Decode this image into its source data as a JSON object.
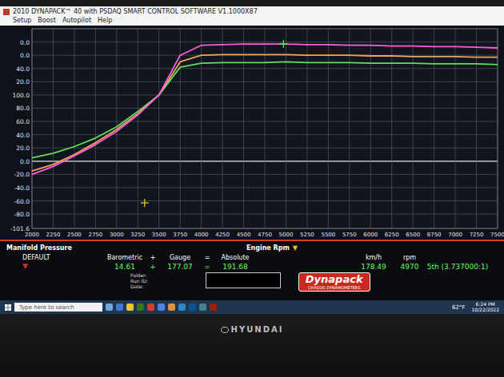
{
  "window": {
    "title": "2010 DYNAPACK™ 40 with PSDAQ SMART CONTROL SOFTWARE V1.1000X87",
    "menu": [
      "Setup",
      "Boost",
      "Autopilot",
      "Help"
    ]
  },
  "chart": {
    "y_ticks": [
      {
        "label": "0.0",
        "value": 180
      },
      {
        "label": "0.0",
        "value": 160
      },
      {
        "label": "40.0",
        "value": 140
      },
      {
        "label": "20.0",
        "value": 120
      },
      {
        "label": "100.0",
        "value": 100
      },
      {
        "label": "80.0",
        "value": 80
      },
      {
        "label": "60.0",
        "value": 60
      },
      {
        "label": "40.0",
        "value": 40
      },
      {
        "label": "20.0",
        "value": 20
      },
      {
        "label": "0.0",
        "value": 0
      },
      {
        "label": "-20.0",
        "value": -20
      },
      {
        "label": "-40.0",
        "value": -40
      },
      {
        "label": "-60.0",
        "value": -60
      },
      {
        "label": "-80.0",
        "value": -80
      },
      {
        "label": "-101.6",
        "value": -101.6
      }
    ],
    "x_ticks": [
      "2000",
      "2250",
      "2500",
      "2750",
      "3000",
      "3250",
      "3500",
      "3750",
      "4000",
      "4250",
      "4500",
      "4750",
      "5000",
      "5250",
      "5500",
      "5750",
      "6000",
      "6250",
      "6500",
      "6750",
      "7000",
      "7250",
      "7500"
    ],
    "rpm": [
      2000,
      2250,
      2500,
      2750,
      3000,
      3250,
      3500,
      3750,
      4000,
      4250,
      4500,
      4750,
      5000,
      5250,
      5500,
      5750,
      6000,
      6250,
      6500,
      6750,
      7000,
      7250,
      7500
    ],
    "series": [
      {
        "color": "#5ee05e",
        "values": [
          5,
          12,
          22,
          35,
          52,
          75,
          100,
          142,
          148,
          149,
          149,
          149,
          150,
          149,
          149,
          149,
          148,
          148,
          148,
          147,
          147,
          147,
          146
        ]
      },
      {
        "color": "#f0a060",
        "values": [
          -15,
          -5,
          10,
          28,
          48,
          72,
          100,
          150,
          160,
          161,
          161,
          161,
          161,
          160,
          160,
          160,
          159,
          159,
          158,
          158,
          158,
          157,
          157
        ]
      },
      {
        "color": "#ff5ce0",
        "values": [
          -20,
          -8,
          8,
          25,
          45,
          70,
          100,
          160,
          175,
          176,
          177,
          177,
          177,
          176,
          176,
          175,
          175,
          174,
          174,
          173,
          173,
          172,
          171
        ]
      }
    ],
    "cursors": [
      {
        "rpm": 4970,
        "value": 177.07,
        "color": "#4cff4c"
      },
      {
        "rpm": 3330,
        "value": -63,
        "color": "#f0d020"
      }
    ]
  },
  "readout": {
    "channel": "Manifold Pressure",
    "x_title": "Engine Rpm",
    "x_title_icon": "▼",
    "preset": "DEFAULT",
    "preset_icon": "▼",
    "labels": [
      "Barometric",
      "+",
      "Gauge",
      "=",
      "Absolute"
    ],
    "values": [
      "14.61",
      "+",
      "177.07",
      "=",
      "191.68"
    ],
    "speed_labels": [
      "km/h",
      "rpm",
      ""
    ],
    "speed_values": [
      "178.49",
      "4970",
      "5th (3.737000:1)"
    ],
    "run_info": [
      "Folder:",
      "Run ID:",
      "Date:"
    ],
    "logo": {
      "name": "Dynapack",
      "tagline": "CHASSIS DYNAMOMETERS"
    }
  },
  "taskbar": {
    "search": "Type here to search",
    "weather": "62°F",
    "time": "6:24 PM",
    "date": "10/22/2022"
  },
  "monitor": {
    "brand": "HYUNDAI"
  }
}
